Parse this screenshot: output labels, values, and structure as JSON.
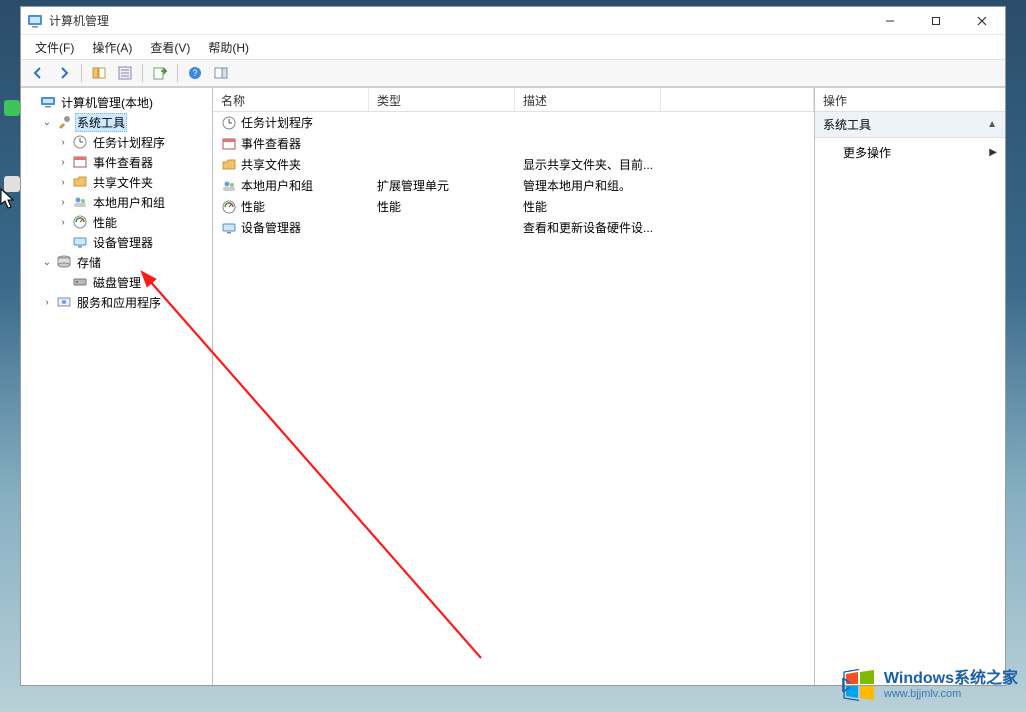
{
  "window": {
    "title": "计算机管理"
  },
  "menu": {
    "file": "文件(F)",
    "action": "操作(A)",
    "view": "查看(V)",
    "help": "帮助(H)"
  },
  "tree": {
    "root": "计算机管理(本地)",
    "system_tools": "系统工具",
    "task_scheduler": "任务计划程序",
    "event_viewer": "事件查看器",
    "shared_folders": "共享文件夹",
    "local_users": "本地用户和组",
    "performance": "性能",
    "device_manager": "设备管理器",
    "storage": "存储",
    "disk_management": "磁盘管理",
    "services_apps": "服务和应用程序"
  },
  "list": {
    "headers": {
      "name": "名称",
      "type": "类型",
      "description": "描述"
    },
    "rows": [
      {
        "name": "任务计划程序",
        "type": "",
        "desc": "",
        "icon": "clock"
      },
      {
        "name": "事件查看器",
        "type": "",
        "desc": "",
        "icon": "event"
      },
      {
        "name": "共享文件夹",
        "type": "",
        "desc": "显示共享文件夹、目前...",
        "icon": "folder-share"
      },
      {
        "name": "本地用户和组",
        "type": "扩展管理单元",
        "desc": "管理本地用户和组。",
        "icon": "users"
      },
      {
        "name": "性能",
        "type": "性能",
        "desc": "性能",
        "icon": "perf"
      },
      {
        "name": "设备管理器",
        "type": "",
        "desc": "查看和更新设备硬件设...",
        "icon": "device"
      }
    ]
  },
  "actions": {
    "header": "操作",
    "group": "系统工具",
    "more": "更多操作"
  },
  "watermark": {
    "brand": "Windows",
    "cn": "系统之家",
    "url": "www.bjjmlv.com"
  }
}
